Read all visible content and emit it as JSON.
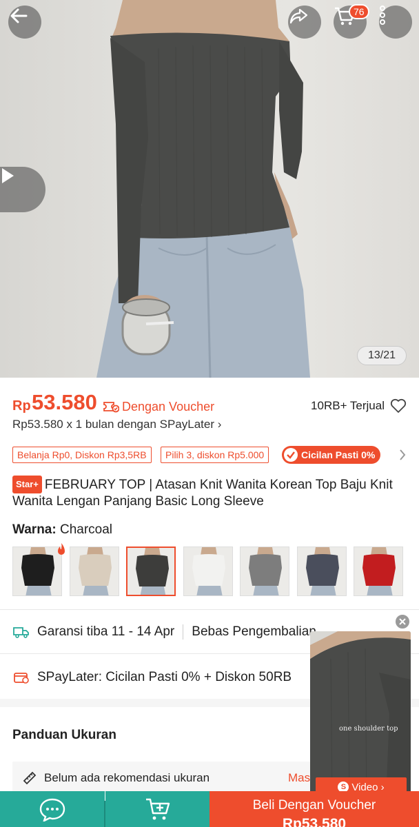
{
  "hero": {
    "image_counter": "13/21",
    "cart_badge": "76",
    "icons": {
      "back": "back-arrow-icon",
      "share": "share-icon",
      "cart": "cart-icon",
      "more": "more-vertical-icon",
      "play": "play-icon"
    }
  },
  "price": {
    "currency": "Rp",
    "value": "53.580",
    "voucher_label": "Dengan Voucher",
    "sold": "10RB+ Terjual",
    "paylater_line": "Rp53.580 x 1 bulan dengan SPayLater ›"
  },
  "promos": {
    "tag1": "Belanja Rp0, Diskon Rp3,5RB",
    "tag2": "Pilih 3, diskon Rp5.000",
    "cicilan": "Cicilan Pasti 0%"
  },
  "product": {
    "badge": "Star+",
    "title": "FEBRUARY TOP | Atasan Knit Wanita Korean Top Baju Knit Wanita Lengan Panjang Basic Long Sleeve"
  },
  "variant": {
    "label": "Warna:",
    "selected": "Charcoal",
    "swatch_colors": [
      "#1e1e1e",
      "#d9cdbd",
      "#3d3d3b",
      "#f2f2f0",
      "#7d7d7d",
      "#4a4e5c",
      "#c21d1f"
    ]
  },
  "delivery": {
    "guarantee": "Garansi tiba 11 - 14 Apr",
    "returns": "Bebas Pengembalian",
    "spaylater": "SPayLater: Cicilan Pasti 0% + Diskon 50RB"
  },
  "size_guide": {
    "title": "Panduan Ukuran",
    "recommendation": "Belum ada rekomendasi ukuran",
    "action": "Masu"
  },
  "float_video": {
    "caption": "one shoulder top",
    "button": "Video ›"
  },
  "bottom": {
    "buy_line1": "Beli Dengan Voucher",
    "buy_line2": "Rp53.580"
  },
  "colors": {
    "accent": "#ee4d2d",
    "teal": "#26aa99"
  }
}
